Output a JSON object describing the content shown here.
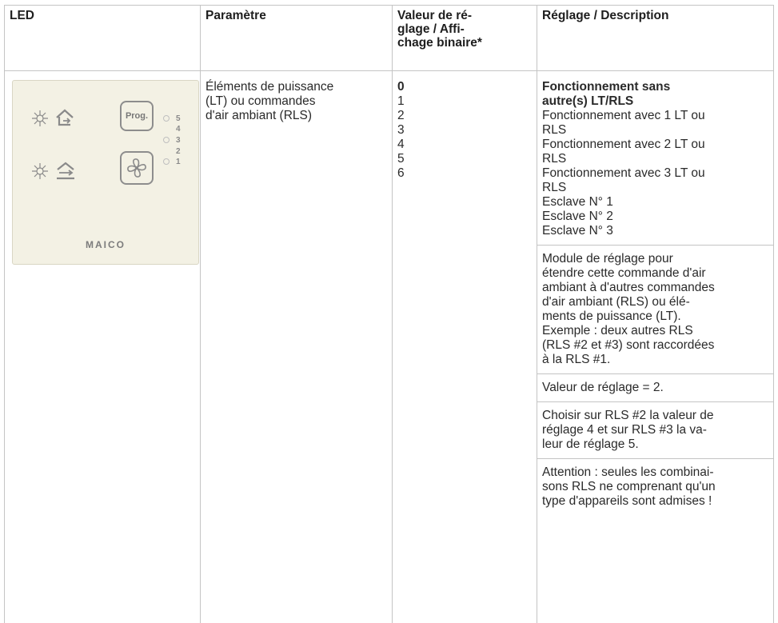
{
  "headers": {
    "led": "LED",
    "parametre": "Paramètre",
    "valeur": [
      "Valeur de ré-",
      "glage / Affi-",
      "chage binaire*"
    ],
    "reglage": "Réglage / Description"
  },
  "panel": {
    "prog_label": "Prog.",
    "led_numbers": [
      "5",
      "4",
      "3",
      "2",
      "1"
    ],
    "brand": "MAICO"
  },
  "parametre": [
    "Éléments de puissance",
    "(LT) ou commandes",
    "d'air ambiant (RLS)"
  ],
  "values": [
    "0",
    "1",
    "2",
    "3",
    "4",
    "5",
    "6"
  ],
  "description": {
    "block1": [
      "Fonctionnement sans",
      "autre(s) LT/RLS",
      "Fonctionnement avec 1 LT ou",
      "RLS",
      "Fonctionnement avec 2 LT ou",
      "RLS",
      "Fonctionnement avec 3 LT ou",
      "RLS",
      "Esclave N° 1",
      "Esclave N° 2",
      "Esclave N° 3"
    ],
    "block2": [
      "Module de réglage pour",
      "étendre cette commande d'air",
      "ambiant à d'autres commandes",
      "d'air ambiant (RLS) ou élé-",
      "ments de puissance (LT).",
      "Exemple : deux autres RLS",
      "(RLS #2 et #3) sont raccordées",
      "à la RLS #1."
    ],
    "block3": [
      "Valeur de réglage = 2."
    ],
    "block4": [
      "Choisir sur RLS #2 la valeur de",
      "réglage 4 et sur RLS #3 la va-",
      "leur de réglage 5."
    ],
    "block5": [
      "Attention : seules les combinai-",
      "sons RLS ne comprenant qu'un",
      "type d'appareils sont admises !"
    ]
  },
  "icons": [
    "sun-icon",
    "house-exhaust-icon",
    "house-supply-icon",
    "fan-icon"
  ]
}
